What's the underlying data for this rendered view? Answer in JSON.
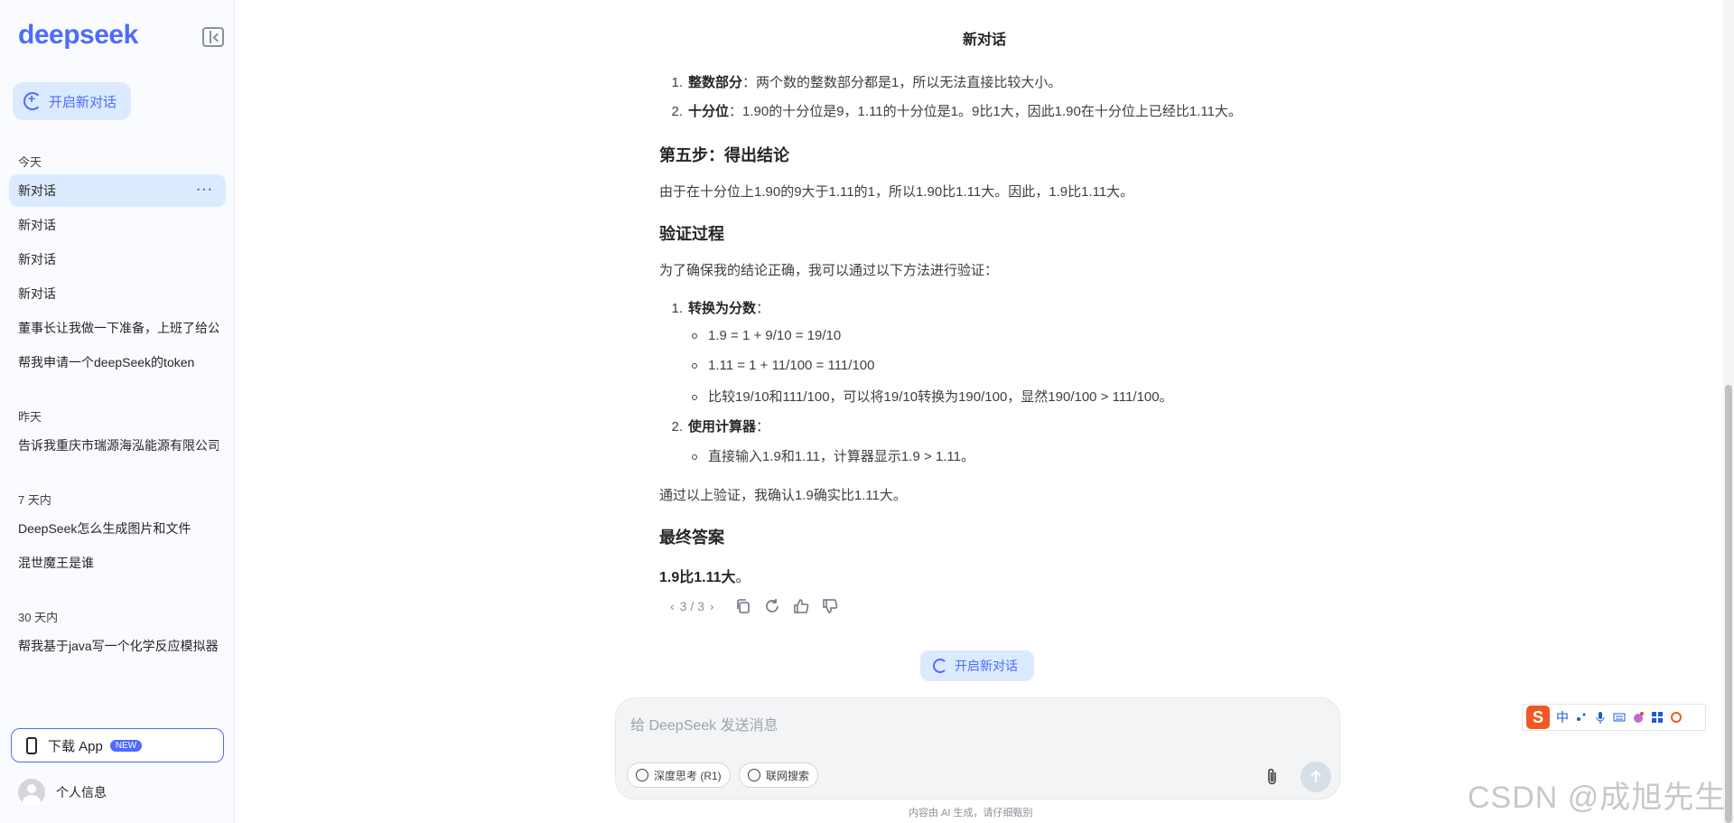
{
  "sidebar": {
    "logo": "deepseek",
    "new_chat_label": "开启新对话",
    "groups": [
      {
        "label": "今天"
      },
      {
        "label": "昨天"
      },
      {
        "label": "7 天内"
      },
      {
        "label": "30 天内"
      }
    ],
    "conversations": [
      "新对话",
      "新对话",
      "新对话",
      "新对话",
      "董事长让我做一下准备，上班了给公",
      "帮我申请一个deepSeek的token",
      "告诉我重庆市瑞源海泓能源有限公司",
      "DeepSeek怎么生成图片和文件",
      "混世魔王是谁",
      "帮我基于java写一个化学反应模拟器"
    ],
    "more_glyph": "···",
    "download_label": "下载 App",
    "new_badge": "NEW",
    "profile_label": "个人信息"
  },
  "main": {
    "title": "新对话",
    "content": {
      "l1_num": "1.",
      "l1_bold": "整数部分",
      "l1_text": "：两个数的整数部分都是1，所以无法直接比较大小。",
      "l2_num": "2.",
      "l2_bold": "十分位",
      "l2_text": "：1.90的十分位是9，1.11的十分位是1。9比1大，因此1.90在十分位上已经比1.11大。",
      "h_step5": "第五步：得出结论",
      "p_step5": "由于在十分位上1.90的9大于1.11的1，所以1.90比1.11大。因此，1.9比1.11大。",
      "h_verify": "验证过程",
      "p_verify": "为了确保我的结论正确，我可以通过以下方法进行验证：",
      "v1_num": "1.",
      "v1_bold": "转换为分数",
      "v1_colon": "：",
      "v1_b1": "1.9 = 1 + 9/10 = 19/10",
      "v1_b2": "1.11 = 1 + 11/100 = 111/100",
      "v1_b3": "比较19/10和111/100，可以将19/10转换为190/100，显然190/100 > 111/100。",
      "v2_num": "2.",
      "v2_bold": "使用计算器",
      "v2_colon": "：",
      "v2_b1": "直接输入1.9和1.11，计算器显示1.9 > 1.11。",
      "p_confirm": "通过以上验证，我确认1.9确实比1.11大。",
      "h_final": "最终答案",
      "final_bold": "1.9比1.11大",
      "final_end": "。"
    },
    "pager": "3 / 3",
    "new_chat_pill": "开启新对话",
    "input_placeholder": "给 DeepSeek 发送消息",
    "chip_deep": "深度思考 (R1)",
    "chip_search": "联网搜索",
    "footer_note": "内容由 AI 生成，请仔细甄别"
  },
  "ime": {
    "logo": "S",
    "zh": "中"
  },
  "watermark": "CSDN @成旭先生",
  "colors": {
    "accent": "#4d6bfe",
    "accent_soft": "#dbeafe",
    "sidebar_bg": "#f9fbff"
  }
}
